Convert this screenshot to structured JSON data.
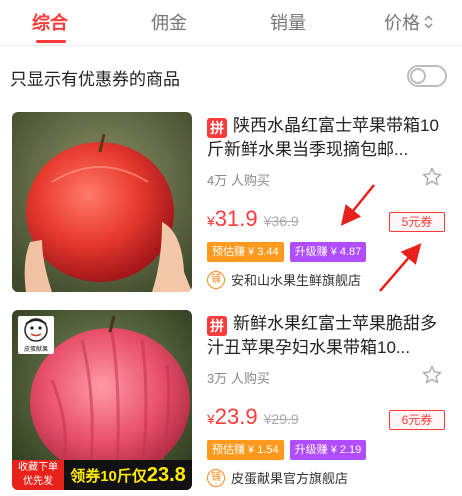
{
  "tabs": [
    {
      "label": "综合",
      "active": true
    },
    {
      "label": "佣金",
      "active": false
    },
    {
      "label": "销量",
      "active": false
    },
    {
      "label": "价格",
      "active": false
    }
  ],
  "filter": {
    "label": "只显示有优惠券的商品",
    "enabled": false
  },
  "products": [
    {
      "badge": "拼",
      "title": "陕西水晶红富士苹果带箱10斤新鲜水果当季现摘包邮...",
      "sold": "4万 人购买",
      "currency": "¥",
      "price": "31.9",
      "original_price": "36.9",
      "coupon": "5元券",
      "earn_estimate": "预估赚 ¥ 3.44",
      "earn_upgrade": "升级赚 ¥ 4.87",
      "shop_icon": "铺",
      "shop": "安和山水果生鲜旗舰店"
    },
    {
      "badge": "拼",
      "title": "新鲜水果红富士苹果脆甜多汁丑苹果孕妇水果带箱10...",
      "sold": "3万 人购买",
      "currency": "¥",
      "price": "23.9",
      "original_price": "29.9",
      "coupon": "6元券",
      "earn_estimate": "预估赚 ¥ 1.54",
      "earn_upgrade": "升级赚 ¥ 2.19",
      "shop_icon": "铺",
      "shop": "皮蛋献果官方旗舰店",
      "image_banner": {
        "left": "收藏下单\n优先发",
        "right_prefix": "领券10斤仅",
        "right_price": "23.8"
      },
      "brand_logo_text": "皮蛋献果"
    }
  ],
  "colors": {
    "accent": "#ff3a3a",
    "earn_estimate": "#ff9a1f",
    "earn_upgrade": "#b04dff",
    "annotation": "#e8221b"
  },
  "icons": {
    "sort": "sort-updown-icon",
    "favorite": "star-outline-icon",
    "shop": "shop-badge-icon"
  }
}
